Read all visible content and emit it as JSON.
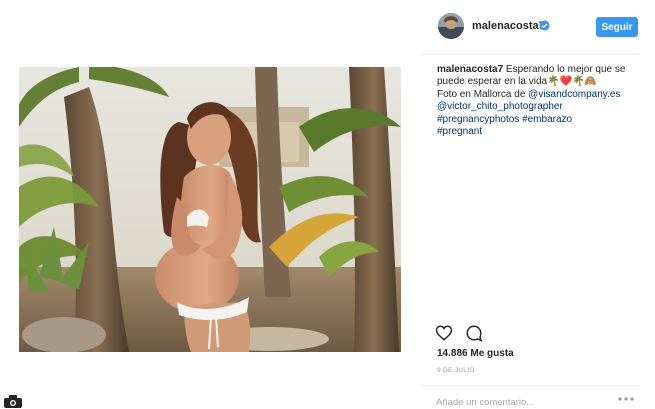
{
  "post": {
    "image_alt": "Foto en Mallorca",
    "header": {
      "username": "malenacosta7",
      "verified_icon": "verified-badge-icon",
      "follow_label": "Seguir"
    },
    "caption": {
      "username": "malenacosta7",
      "text_1": " Esperando lo mejor que se puede esperar en la vida🌴❤️🌴🙈",
      "text_2": "Foto en Mallorca de ",
      "mention_1": "@visandcompany.es",
      "mention_2": "@victor_chito_photographer",
      "hashtags_1": "#pregnancyphotos #embarazo",
      "hashtags_2": "#pregnant"
    },
    "actions": {
      "like_icon": "heart-icon",
      "comment_icon": "comment-icon"
    },
    "likes": "14.886 Me gusta",
    "date": "9 DE JULIO",
    "comment": {
      "placeholder": "Añade un comentario...",
      "more_icon": "more-options-icon"
    }
  },
  "page": {
    "camera_icon": "camera-icon"
  },
  "colors": {
    "accent": "#3897f0",
    "link": "#003569",
    "text": "#262626",
    "muted": "#999999",
    "border": "#efefef"
  }
}
